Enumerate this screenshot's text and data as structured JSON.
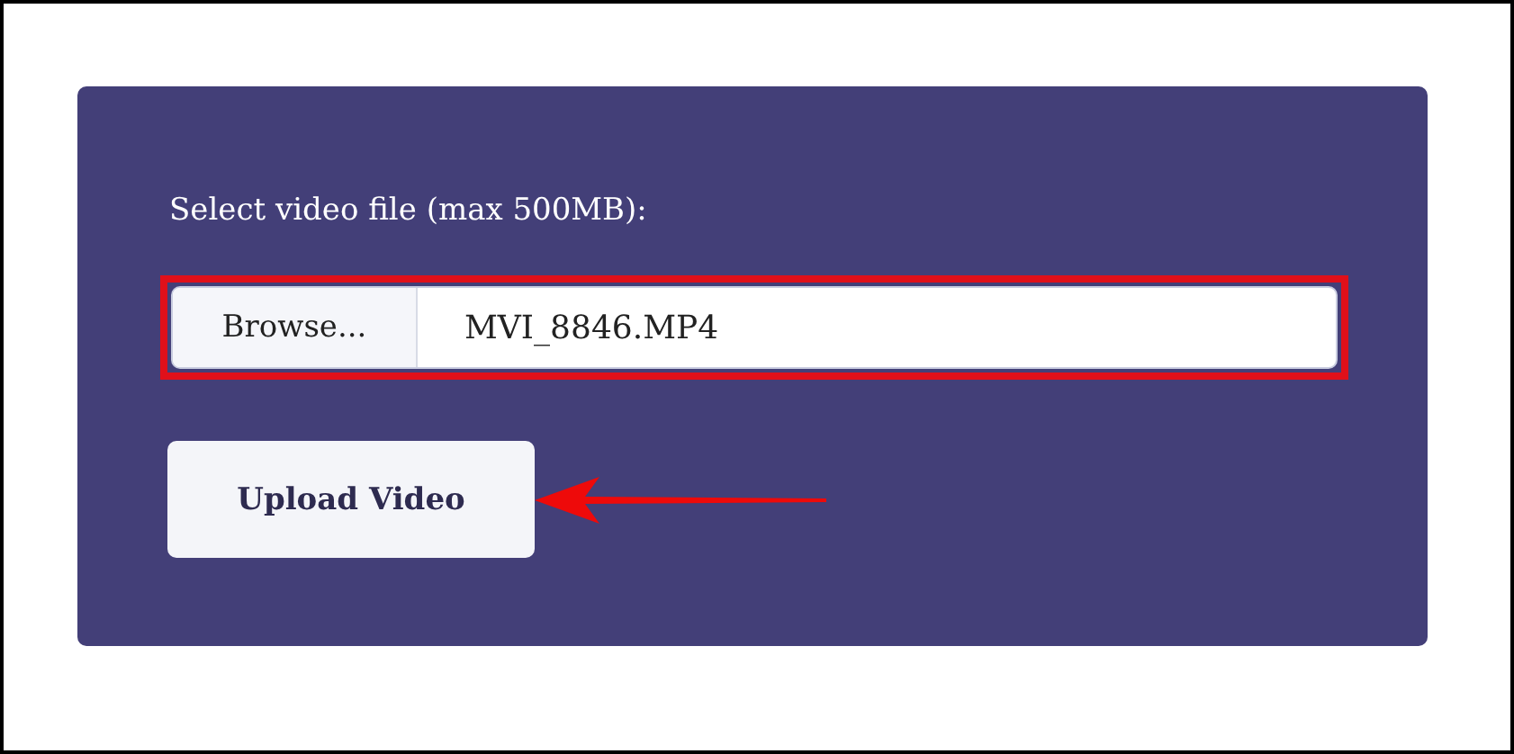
{
  "form": {
    "label": "Select video file (max 500MB):",
    "file_input": {
      "browse_label": "Browse...",
      "value": "MVI_8846.MP4"
    },
    "submit_button": {
      "label": "Upload Video"
    }
  }
}
